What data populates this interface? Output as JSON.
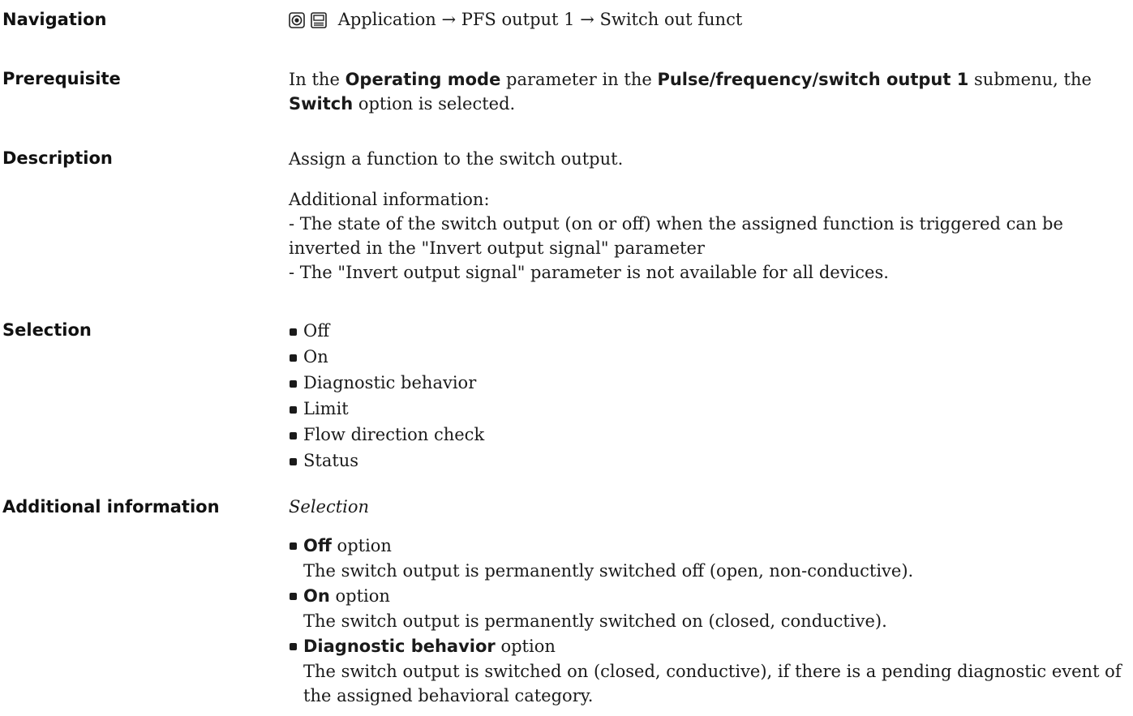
{
  "navigation": {
    "label": "Navigation",
    "icons": [
      "operation-icon",
      "display-icon"
    ],
    "path": "Application → PFS output 1 → Switch out funct"
  },
  "prerequisite": {
    "label": "Prerequisite",
    "t1": "In the ",
    "b1": "Operating mode",
    "t2": " parameter in the ",
    "b2": "Pulse/frequency/switch output 1",
    "t3": " submenu, the",
    "b3": "Switch",
    "t4": " option is selected."
  },
  "description": {
    "label": "Description",
    "line1": "Assign a function to the switch output.",
    "additional_heading": "Additional information:",
    "line2": "- The state of the switch output (on or off) when the assigned function is triggered can be",
    "line3": "inverted in the \"Invert output signal\" parameter",
    "line4": "- The \"Invert output signal\" parameter is not available for all devices."
  },
  "selection": {
    "label": "Selection",
    "options": [
      "Off",
      "On",
      "Diagnostic behavior",
      "Limit",
      "Flow direction check",
      "Status"
    ]
  },
  "additional_information": {
    "label": "Additional information",
    "subheading": "Selection",
    "items": [
      {
        "name": "Off",
        "suffix": " option",
        "desc": "The switch output is permanently switched off (open, non-conductive)."
      },
      {
        "name": "On",
        "suffix": " option",
        "desc": "The switch output is permanently switched on (closed, conductive)."
      },
      {
        "name": "Diagnostic behavior",
        "suffix": " option",
        "desc": "The switch output is switched on (closed, conductive), if there is a pending diagnostic event of the assigned behavioral category."
      }
    ]
  }
}
